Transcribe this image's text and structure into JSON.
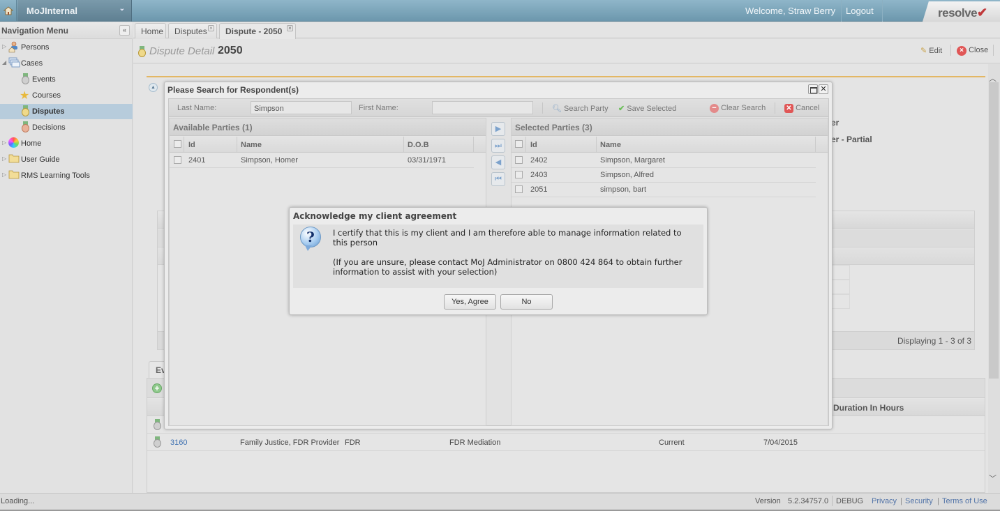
{
  "topbar": {
    "app_name": "MoJInternal",
    "welcome": "Welcome, Straw Berry",
    "logout": "Logout",
    "logo_text": "resolve",
    "logo_mark": "✔"
  },
  "sidebar": {
    "title": "Navigation Menu",
    "collapse_glyph": "«",
    "items": [
      {
        "label": "Persons",
        "icon": "persons-icon",
        "expander": "▷"
      },
      {
        "label": "Cases",
        "icon": "cases-icon",
        "expander": "◢"
      },
      {
        "label": "Events",
        "icon": "events-medal-icon"
      },
      {
        "label": "Courses",
        "icon": "star-icon"
      },
      {
        "label": "Disputes",
        "icon": "disputes-medal-icon",
        "selected": true
      },
      {
        "label": "Decisions",
        "icon": "decisions-medal-icon"
      },
      {
        "label": "Home",
        "icon": "color-wheel-icon",
        "expander": "▷"
      },
      {
        "label": "User Guide",
        "icon": "folder-icon",
        "expander": "▷"
      },
      {
        "label": "RMS Learning Tools",
        "icon": "folder-icon",
        "expander": "▷"
      }
    ]
  },
  "tabs": [
    {
      "label": "Home",
      "closable": false
    },
    {
      "label": "Disputes",
      "closable": true
    },
    {
      "label": "Dispute - 2050",
      "closable": true,
      "active": true
    }
  ],
  "detail": {
    "label": "Dispute Detail",
    "number": "2050",
    "edit": "Edit",
    "close": "Close"
  },
  "background": {
    "partial_text_1": "er",
    "partial_text_2": "er - Partial",
    "grid_footer": "Displaying 1 - 3 of 3",
    "events_tab": "Ev",
    "duration_col": "Duration In Hours",
    "event_row": {
      "id": "3160",
      "provider": "Family Justice, FDR Provider",
      "type": "FDR",
      "name": "FDR Mediation",
      "status": "Current",
      "date": "7/04/2015"
    }
  },
  "search_window": {
    "title": "Please Search for Respondent(s)",
    "last_name_label": "Last Name:",
    "last_name_value": "Simpson",
    "first_name_label": "First Name:",
    "first_name_value": "",
    "buttons": {
      "search": "Search Party",
      "save": "Save Selected",
      "clear": "Clear Search",
      "cancel": "Cancel"
    },
    "available": {
      "title": "Available Parties (1)",
      "columns": [
        "Id",
        "Name",
        "D.O.B"
      ],
      "rows": [
        {
          "id": "2401",
          "name": "Simpson, Homer",
          "dob": "03/31/1971"
        }
      ]
    },
    "selected": {
      "title": "Selected Parties (3)",
      "columns": [
        "Id",
        "Name"
      ],
      "rows": [
        {
          "id": "2402",
          "name": "Simpson, Margaret"
        },
        {
          "id": "2403",
          "name": "Simpson, Alfred"
        },
        {
          "id": "2051",
          "name": "simpson, bart"
        }
      ]
    },
    "move_buttons": [
      "▶",
      "⏭",
      "◀",
      "⏮"
    ]
  },
  "dialog": {
    "title": "Acknowledge my client agreement",
    "icon_glyph": "?",
    "message_1": "I certify that this is my client and I am therefore able to manage information related to this person",
    "message_2": "(If you are unsure, please contact MoJ Administrator on 0800 424 864 to obtain further information to assist with your selection)",
    "yes": "Yes, Agree",
    "no": "No"
  },
  "statusbar": {
    "loading": "Loading...",
    "version_label": "Version",
    "version": "5.2.34757.0",
    "build": "DEBUG",
    "links": [
      "Privacy",
      "Security",
      "Terms of Use"
    ]
  },
  "colors": {
    "topbar": "#7aa3b8",
    "accent_line": "#e3b764",
    "selected_nav": "#b7ccdc",
    "link": "#5274a8"
  }
}
